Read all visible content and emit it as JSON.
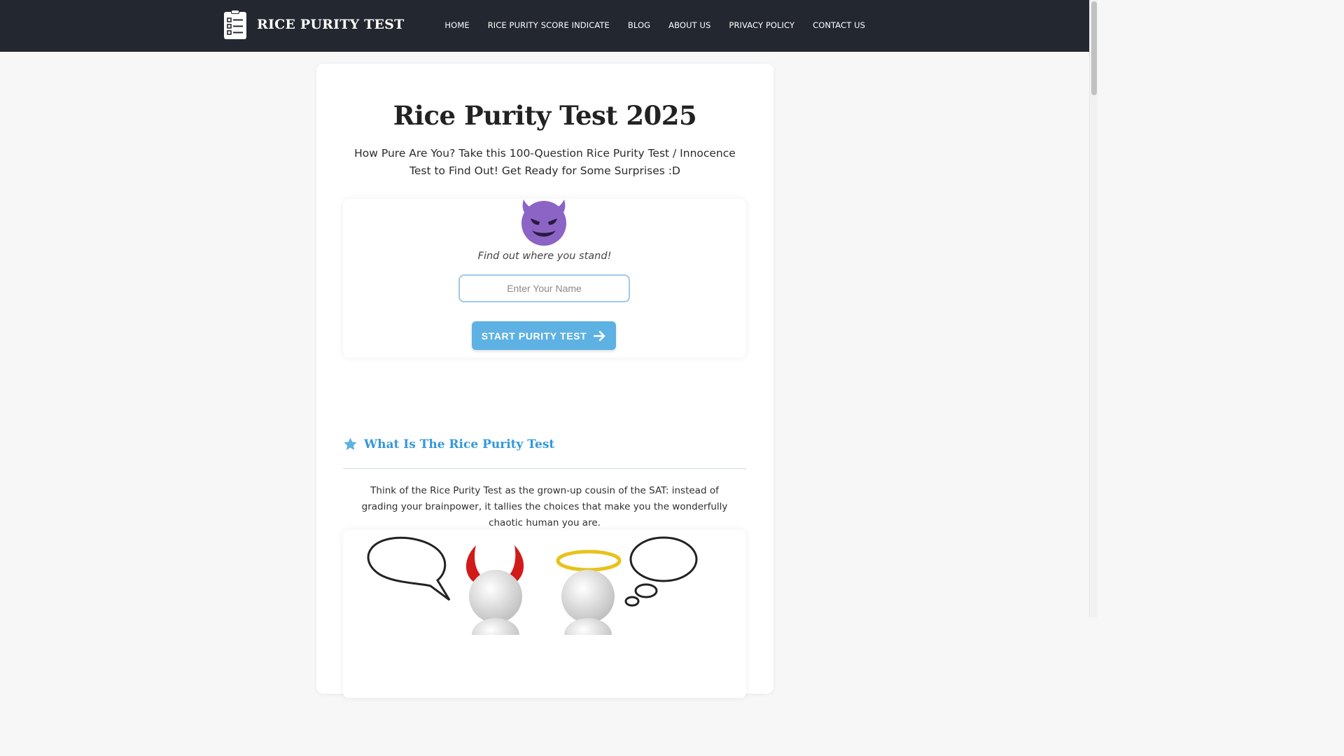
{
  "header": {
    "site_name": "RICE PURITY TEST",
    "logo_icon": "clipboard-checklist-icon",
    "nav": [
      {
        "label": "HOME"
      },
      {
        "label": "RICE PURITY SCORE INDICATE"
      },
      {
        "label": "BLOG"
      },
      {
        "label": "ABOUT US"
      },
      {
        "label": "PRIVACY POLICY"
      },
      {
        "label": "CONTACT US"
      }
    ]
  },
  "main": {
    "title": "Rice Purity Test 2025",
    "subtitle": "How Pure Are You? Take this 100-Question Rice Purity Test / Innocence Test to Find Out! Get Ready for Some Surprises :D",
    "start_card": {
      "emoji_icon": "smiling-devil-icon",
      "tagline": "Find out where you stand!",
      "name_input": {
        "value": "",
        "placeholder": "Enter Your Name"
      },
      "start_button": "START PURITY TEST",
      "button_icon": "arrow-right-icon"
    },
    "section": {
      "icon": "star-icon",
      "title": "What Is The Rice Purity Test",
      "paragraph": "Think of the Rice Purity Test as the grown-up cousin of the SAT: instead of grading your brainpower, it tallies the choices that make you the wonderfully chaotic human you are."
    },
    "illustration": "devil-and-angel-thought-bubbles-illustration"
  },
  "colors": {
    "header_bg": "#23272f",
    "accent": "#3498db",
    "button": "#5eb1e3",
    "page_bg": "#f7f7f8"
  }
}
